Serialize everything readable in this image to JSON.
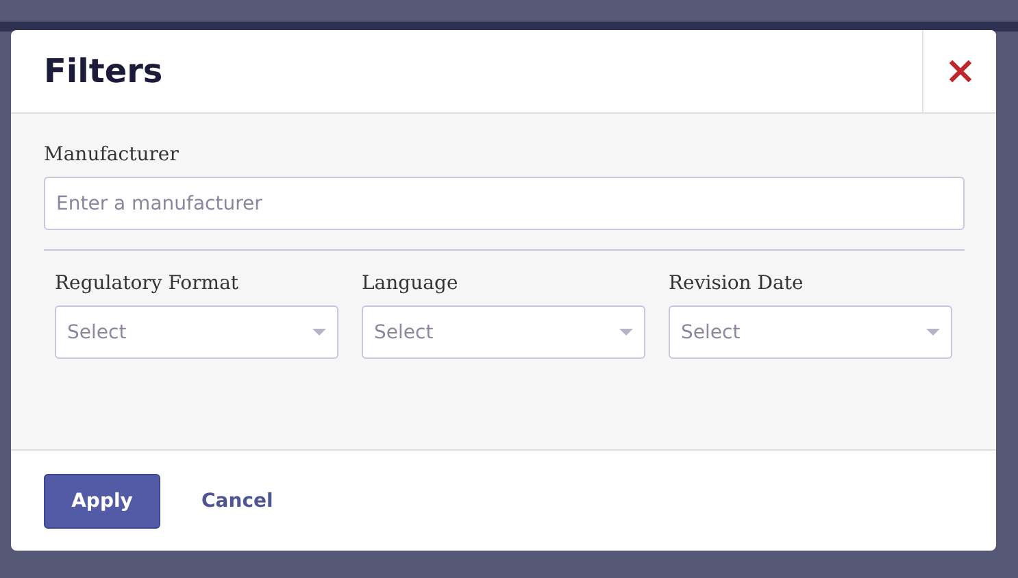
{
  "dialog": {
    "title": "Filters",
    "manufacturer": {
      "label": "Manufacturer",
      "placeholder": "Enter a manufacturer"
    },
    "selects": [
      {
        "label": "Regulatory Format",
        "placeholder": "Select"
      },
      {
        "label": "Language",
        "placeholder": "Select"
      },
      {
        "label": "Revision Date",
        "placeholder": "Select"
      }
    ],
    "buttons": {
      "apply": "Apply",
      "cancel": "Cancel"
    }
  }
}
